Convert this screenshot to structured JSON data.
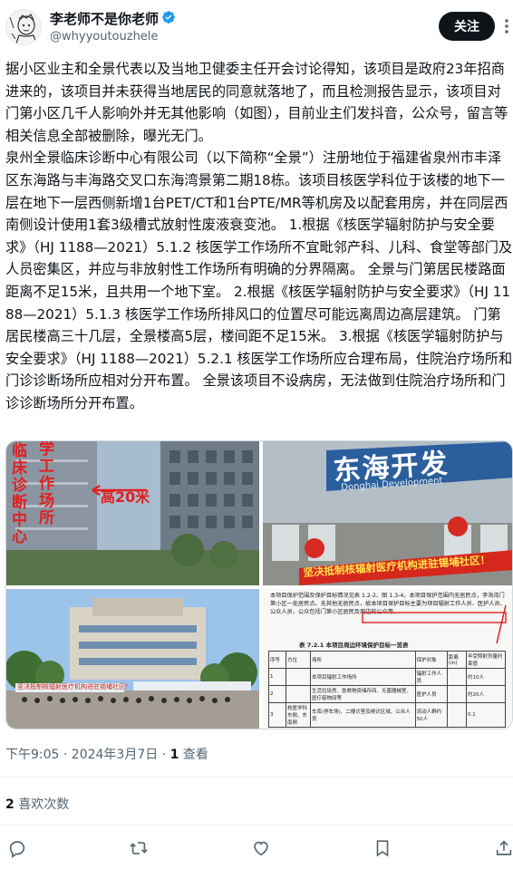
{
  "author": {
    "name": "李老师不是你老师",
    "handle": "@whyyoutouzhele"
  },
  "follow_label": "关注",
  "body": "据小区业主和全景代表以及当地卫健委主任开会讨论得知，该项目是政府23年招商进来的，该项目并未获得当地居民的同意就落地了，而且检测报告显示，该项目对门第小区几千人影响外并无其他影响（如图），目前业主们发抖音，公众号，留言等相关信息全部被删除，曝光无门。\n泉州全景临床诊断中心有限公司（以下简称“全景”）注册地位于福建省泉州市丰泽区东海路与丰海路交叉口东海湾景第二期18栋。该项目核医学科位于该楼的地下一层在地下一层西侧新增1台PET/CT和1台PTE/MR等机房及以配套用房，并在同层西南侧设计使用1套3级槽式放射性废液衰变池。 1.根据《核医学辐射防护与安全要求》（HJ 1188—2021）5.1.2 核医学工作场所不宜毗邻产科、儿科、食堂等部门及人员密集区，并应与非放射性工作场所有明确的分界隔离。 全景与门第居民楼路面距离不足15米，且共用一个地下室。 2.根据《核医学辐射防护与安全要求》（HJ 1188—2021）5.1.3 核医学工作场所排风口的位置尽可能远离周边高层建筑。 门第居民楼高三十几层，全景楼高5层，楼间距不足15米。 3.根据《核医学辐射防护与安全要求》（HJ 1188—2021）5.2.1 核医学工作场所应合理布局，住院治疗场所和门诊诊断场所应相对分开布置。 全景该项目不设病房，无法做到住院治疗场所和门诊诊断场所分开布置。",
  "photos": {
    "p1_vertical": "临床诊断中心",
    "p1_mid": "学工作场所",
    "p1_height": "高20米",
    "p2_sign": "东海开发",
    "p2_sign_en": "Donghai Development",
    "p2_banner": "坚决抵制核辐射医疗机构进驻锡埔社区！",
    "p3_banner": "坚决抵制核辐射医疗机构进驻锡埔社区！",
    "p4_intro": "本项目保护范围及保护目标情况见表 1.2-2、图 1.3-4。本项目保护范围内无居民点，李海湾门第小区一处居民点。无其他无居民点，故本项目保护目标主要为项目辐射工作人员、医护人员、公众人员，公众包括门第小区居民及周边的公众等。",
    "p4_table_title": "表 7.2.1  本项目周边环境保护目标一览表",
    "p4_headers": [
      "序号",
      "方位",
      "场所",
      "保护对象",
      "距离(m)",
      "年受照射剂量约束值"
    ],
    "p4_rows": [
      [
        "1",
        "本项目辐射工作场所",
        "辐射工作人员",
        "约10人"
      ],
      [
        "2",
        "生活垃圾房、急救物资储存间、无菌器械室、医疗废物间等",
        "医护人员",
        "约20人"
      ],
      [
        "3",
        "核医学科 东侧、东南侧",
        "车库(停车场)、二楼诊室及候诊区域、公众人员",
        "流动人群约50人",
        "0.1"
      ]
    ]
  },
  "timestamp": "下午9:05 · 2024年3月7日 · ",
  "views_count": "1",
  "views_label": " 查看",
  "likes_count": "2",
  "likes_label": " 喜欢次数"
}
